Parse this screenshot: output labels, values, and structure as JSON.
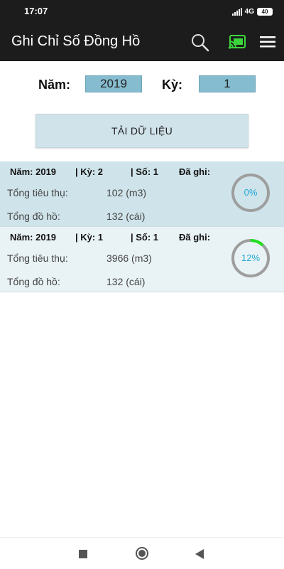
{
  "status_bar": {
    "time": "17:07",
    "network": "4G",
    "battery": "40"
  },
  "app_bar": {
    "title": "Ghi Chỉ Số Đồng Hồ",
    "icons": [
      "search-icon",
      "cast-icon",
      "menu-icon"
    ],
    "accent": "#3cd63c"
  },
  "filter": {
    "year_label": "Năm:",
    "year_value": "2019",
    "period_label": "Kỳ:",
    "period_value": "1"
  },
  "load_button": {
    "label": "TẢI DỮ LIỆU"
  },
  "records": [
    {
      "year": "Năm: 2019",
      "period": "| Kỳ: 2",
      "book": "| Số: 1",
      "recorded_label": "Đã ghi:",
      "consumption_label": "Tổng tiêu thụ:",
      "consumption_value": "102 (m3)",
      "meters_label": "Tổng đồ hồ:",
      "meters_value": "132 (cái)",
      "progress_text": "0%",
      "progress": 0,
      "background": "#cfe3ea"
    },
    {
      "year": "Năm: 2019",
      "period": "| Kỳ: 1",
      "book": "| Số: 1",
      "recorded_label": "Đã ghi:",
      "consumption_label": "Tổng tiêu thụ:",
      "consumption_value": "3966 (m3)",
      "meters_label": "Tổng đồ hồ:",
      "meters_value": "132 (cái)",
      "progress_text": "12%",
      "progress": 0.12,
      "background": "#e9f2f5"
    }
  ],
  "colors": {
    "progress_track": "#9e9e9e",
    "progress_fill": "#22e022",
    "progress_text": "#23a9d6",
    "input_fill": "#86bcd0"
  }
}
